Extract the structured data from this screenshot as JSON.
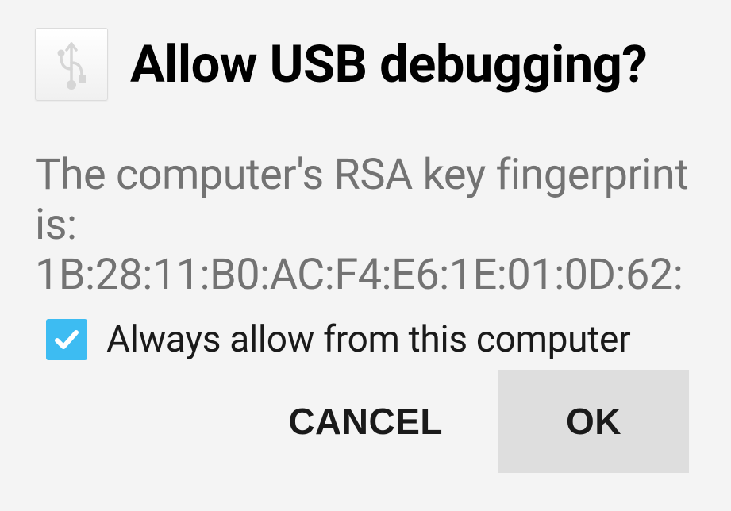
{
  "dialog": {
    "title": "Allow USB debugging?",
    "body_intro": "The computer's RSA key fingerprint is:",
    "fingerprint": "1B:28:11:B0:AC:F4:E6:1E:01:0D:62:",
    "checkbox_label": "Always allow from this computer",
    "checkbox_checked": true,
    "cancel_label": "CANCEL",
    "ok_label": "OK"
  }
}
